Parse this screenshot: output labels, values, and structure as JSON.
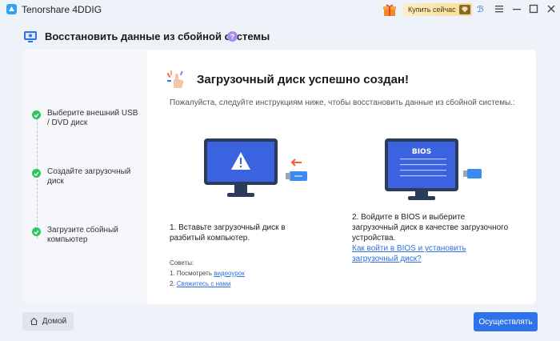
{
  "app": {
    "name": "Tenorshare 4DDIG"
  },
  "titlebar": {
    "buy_label": "Купить сейчас",
    "icons": [
      "gift-icon",
      "diamond-icon",
      "settings-icon",
      "menu-icon",
      "minimize-icon",
      "maximize-icon",
      "close-icon"
    ]
  },
  "header": {
    "title": "Восстановить данные из сбойной системы",
    "help": "?"
  },
  "steps": [
    {
      "label": "Выберите внешний USB / DVD диск"
    },
    {
      "label": "Создайте загрузочный диск"
    },
    {
      "label": "Загрузите сбойный компьютер"
    }
  ],
  "main": {
    "success_title": "Загрузочный диск успешно создан!",
    "instruction": "Пожалуйста, следуйте инструкциям ниже, чтобы восстановить данные из сбойной системы.:",
    "step1_text": "1. Вставьте загрузочный диск в разбитый компьютер.",
    "step2_text": "2. Войдите в BIOS и выберите загрузочный диск в качестве загрузочного устройства.",
    "step2_link": "Как войти в BIOS и установить загрузочный диск?",
    "bios_label": "BIOS",
    "tips": {
      "title": "Советы:",
      "item1_prefix": "1. Посмотреть ",
      "item1_link": "видеоурок",
      "item2_prefix": "2. ",
      "item2_link": "Свяжитесь с нами"
    }
  },
  "footer": {
    "home_label": "Домой",
    "go_label": "Осуществлять"
  },
  "colors": {
    "accent": "#2f73ea",
    "success": "#2ec55e",
    "monitor": "#3b63e0",
    "background": "#eef2f9"
  }
}
